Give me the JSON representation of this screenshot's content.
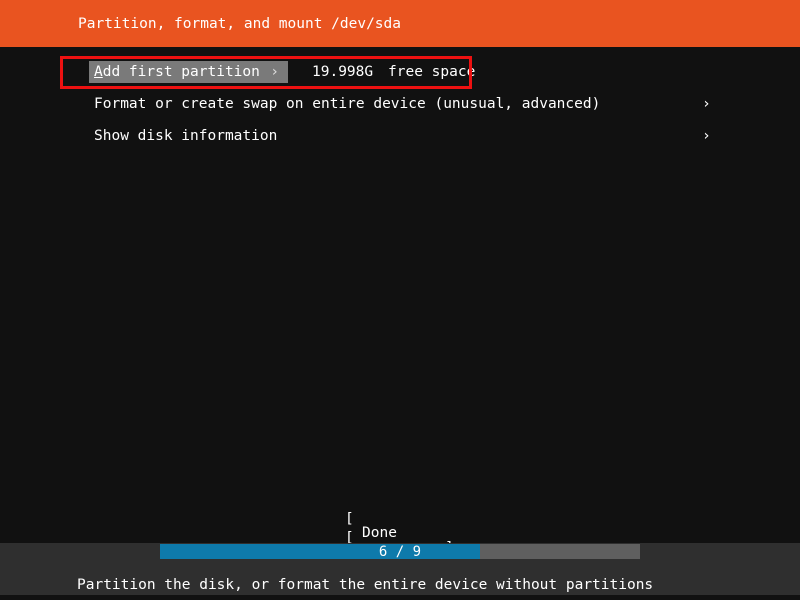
{
  "header": {
    "title": "Partition, format, and mount /dev/sda",
    "background_color": "#e95420",
    "text_color": "#ffffff"
  },
  "annotation": {
    "highlight_box_color": "#ee1111",
    "target": "add-first-partition-row"
  },
  "menu": {
    "selected_index": 0,
    "selection_background": "#7a7a7a",
    "items": [
      {
        "label": "Add first partition",
        "accelerator": "A",
        "chevron": "›",
        "size": "19.998G",
        "description": "free space",
        "selected": true
      },
      {
        "label": "Format or create swap on entire device (unusual, advanced)",
        "chevron": "›",
        "selected": false
      },
      {
        "label": "Show disk information",
        "chevron": "›",
        "selected": false
      }
    ]
  },
  "buttons": [
    {
      "name": "done",
      "label": "Done",
      "bracket_left": "[",
      "bracket_right": "]"
    },
    {
      "name": "cancel",
      "label": "Cancel",
      "bracket_left": "[",
      "bracket_right": "]"
    }
  ],
  "footer": {
    "progress": {
      "label": "6 / 9",
      "current": 6,
      "total": 9,
      "percent": 66.7,
      "fill_color": "#0e7aab",
      "track_color": "#5f5f5f"
    },
    "hint": "Partition the disk, or format the entire device without partitions",
    "strip_color": "#2f2f2f"
  }
}
